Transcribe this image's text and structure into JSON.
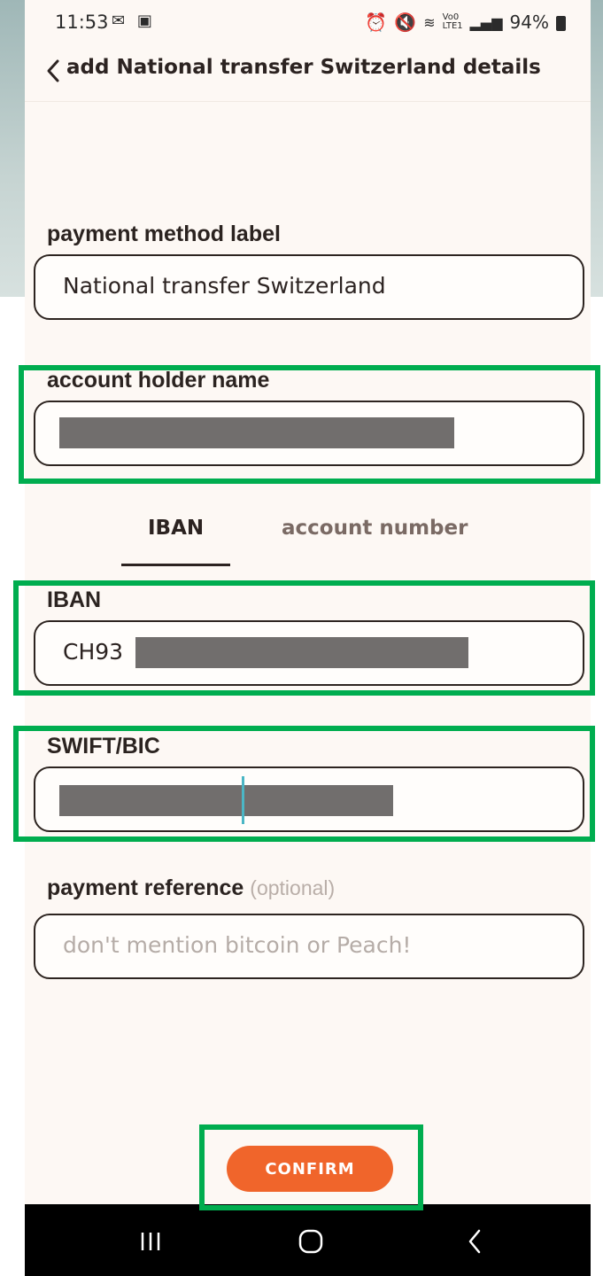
{
  "status_bar": {
    "time": "11:53",
    "left_icons": [
      "message-icon",
      "image-icon"
    ],
    "right_icons": [
      "alarm-icon",
      "mute-icon",
      "wifi-icon",
      "volte-icon",
      "signal-icon"
    ],
    "battery": "94%"
  },
  "header": {
    "title": "add National transfer Switzerland details"
  },
  "fields": {
    "payment_method_label": {
      "label": "payment method label",
      "value": "National transfer Switzerland"
    },
    "account_holder_name": {
      "label": "account holder name",
      "value_redacted": true
    },
    "iban": {
      "label": "IBAN",
      "value_prefix": "CH93",
      "value_redacted": true
    },
    "swift_bic": {
      "label": "SWIFT/BIC",
      "value_redacted": true
    },
    "payment_reference": {
      "label": "payment reference",
      "optional_text": "(optional)",
      "placeholder": "don't mention bitcoin or Peach!"
    }
  },
  "tabs": [
    {
      "label": "IBAN",
      "active": true
    },
    {
      "label": "account number",
      "active": false
    }
  ],
  "confirm_button": {
    "label": "CONFIRM"
  },
  "nav_bar": {
    "buttons": [
      "recent-apps-icon",
      "home-icon",
      "back-icon"
    ]
  },
  "colors": {
    "background": "#fdf8f4",
    "text": "#2c2321",
    "accent": "#f0652b",
    "highlight": "#00ad4f",
    "redaction": "#716e6d"
  }
}
